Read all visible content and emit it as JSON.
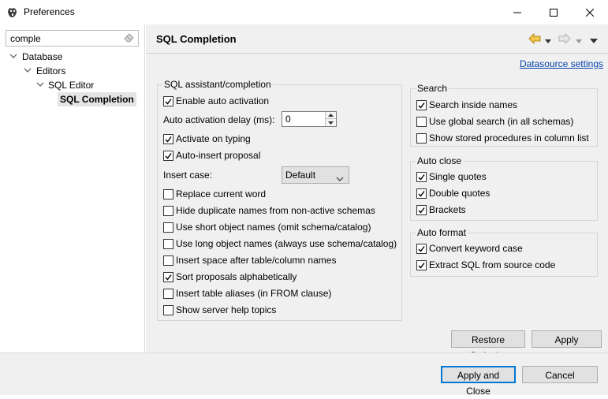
{
  "window": {
    "title": "Preferences",
    "icon": "dbeaver-beaver-icon",
    "controls": [
      "minimize-icon",
      "maximize-icon",
      "close-icon"
    ]
  },
  "sidebar": {
    "filter": {
      "value": "comple",
      "clear_icon": "eraser-icon"
    },
    "tree": [
      {
        "label": "Database",
        "expanded": true,
        "level": 0
      },
      {
        "label": "Editors",
        "expanded": true,
        "level": 1
      },
      {
        "label": "SQL Editor",
        "expanded": true,
        "level": 2
      },
      {
        "label": "SQL Completion",
        "selected": true,
        "level": 3
      }
    ]
  },
  "page": {
    "title": "SQL Completion",
    "nav_icons": [
      "back-arrow-icon",
      "back-dropdown-icon",
      "forward-arrow-icon",
      "forward-dropdown-icon",
      "view-menu-icon"
    ],
    "datasource_link": "Datasource settings"
  },
  "assistant": {
    "title": "SQL assistant/completion",
    "enable_auto_activation": {
      "label": "Enable auto activation",
      "checked": true
    },
    "delay": {
      "label": "Auto activation delay (ms):",
      "value": "0"
    },
    "activate_on_typing": {
      "label": "Activate on typing",
      "checked": true
    },
    "auto_insert": {
      "label": "Auto-insert proposal",
      "checked": true
    },
    "insert_case": {
      "label": "Insert case:",
      "value": "Default"
    },
    "options": [
      {
        "label": "Replace current word",
        "checked": false
      },
      {
        "label": "Hide duplicate names from non-active schemas",
        "checked": false
      },
      {
        "label": "Use short object names (omit schema/catalog)",
        "checked": false
      },
      {
        "label": "Use long object names (always use schema/catalog)",
        "checked": false
      },
      {
        "label": "Insert space after table/column names",
        "checked": false
      },
      {
        "label": "Sort proposals alphabetically",
        "checked": true
      },
      {
        "label": "Insert table aliases (in FROM clause)",
        "checked": false
      },
      {
        "label": "Show server help topics",
        "checked": false
      }
    ]
  },
  "search": {
    "title": "Search",
    "options": [
      {
        "label": "Search inside names",
        "checked": true
      },
      {
        "label": "Use global search (in all schemas)",
        "checked": false
      },
      {
        "label": "Show stored procedures in column list",
        "checked": false
      }
    ]
  },
  "auto_close": {
    "title": "Auto close",
    "options": [
      {
        "label": "Single quotes",
        "checked": true
      },
      {
        "label": "Double quotes",
        "checked": true
      },
      {
        "label": "Brackets",
        "checked": true
      }
    ]
  },
  "auto_format": {
    "title": "Auto format",
    "options": [
      {
        "label": "Convert keyword case",
        "checked": true
      },
      {
        "label": "Extract SQL from source code",
        "checked": true
      }
    ]
  },
  "buttons": {
    "restore_defaults": "Restore Defaults",
    "apply": "Apply",
    "apply_and_close": "Apply and Close",
    "cancel": "Cancel"
  },
  "colors": {
    "link": "#0645ad",
    "primary_border": "#0078d7",
    "selection": "#e4e4e4"
  }
}
